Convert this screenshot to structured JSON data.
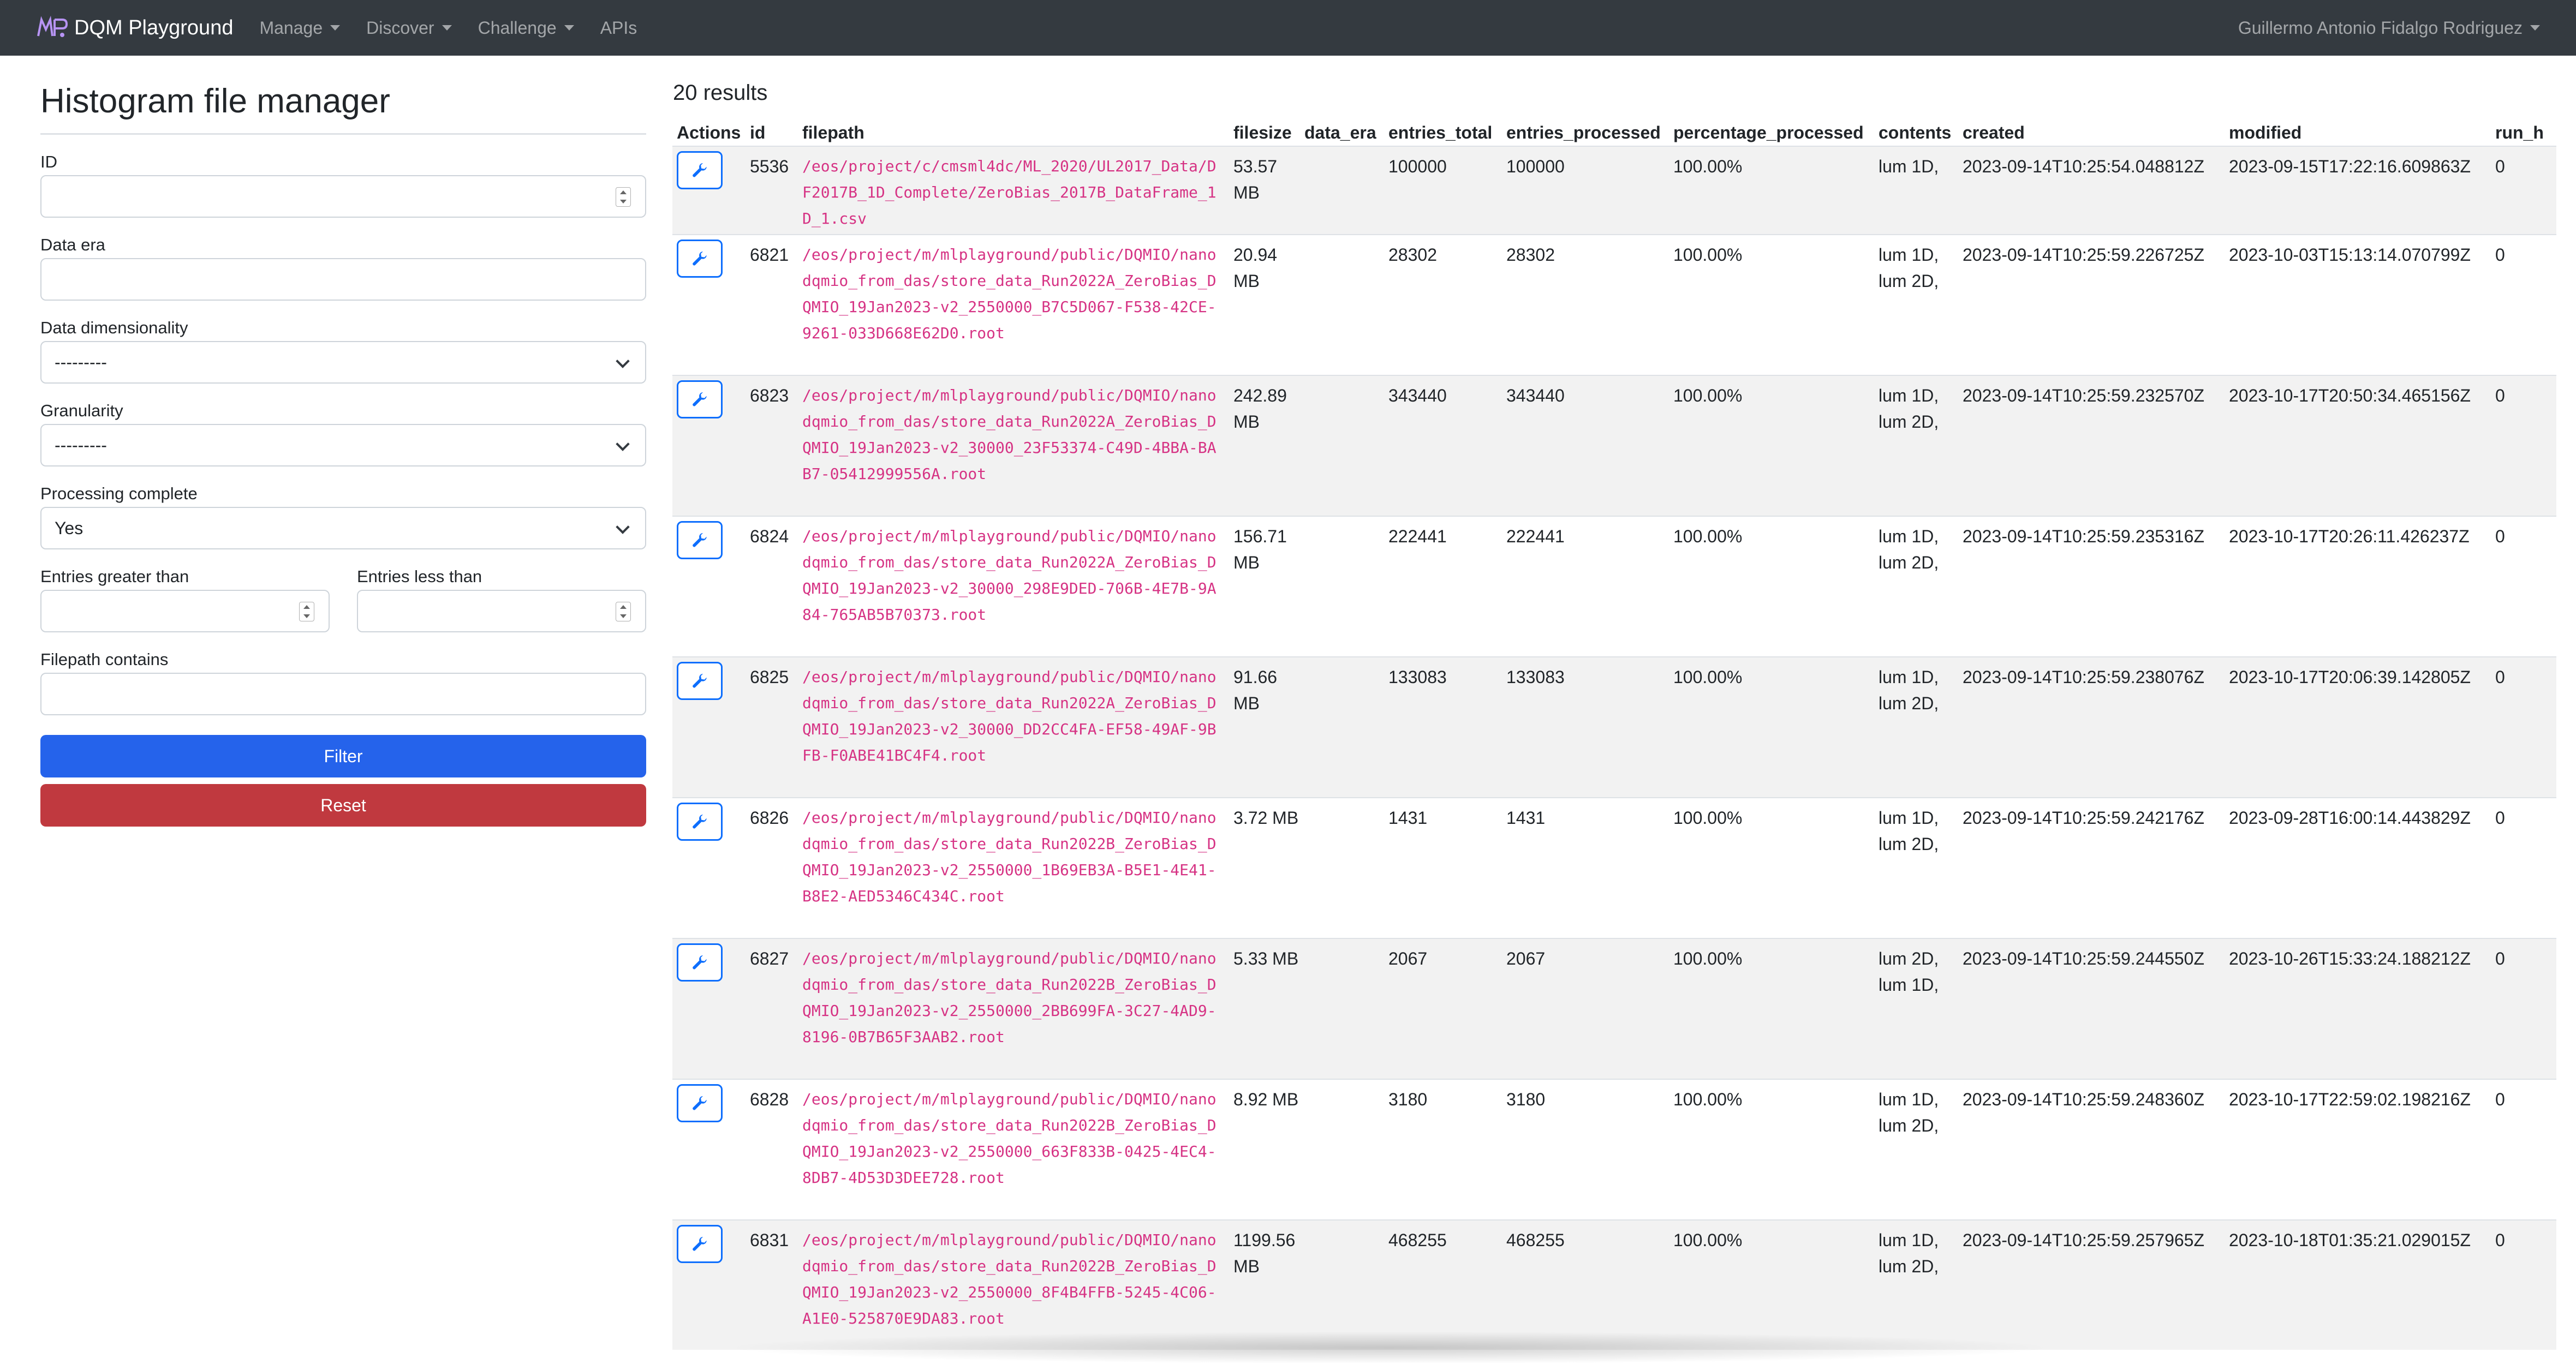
{
  "navbar": {
    "brand": "DQM Playground",
    "menu": [
      {
        "label": "Manage",
        "dropdown": true
      },
      {
        "label": "Discover",
        "dropdown": true
      },
      {
        "label": "Challenge",
        "dropdown": true
      },
      {
        "label": "APIs",
        "dropdown": false
      }
    ],
    "user": "Guillermo Antonio Fidalgo Rodriguez"
  },
  "filter_panel": {
    "title": "Histogram file manager",
    "fields": {
      "id": {
        "label": "ID",
        "value": ""
      },
      "data_era": {
        "label": "Data era",
        "value": ""
      },
      "data_dimensionality": {
        "label": "Data dimensionality",
        "value": "---------"
      },
      "granularity": {
        "label": "Granularity",
        "value": "---------"
      },
      "processing_complete": {
        "label": "Processing complete",
        "value": "Yes"
      },
      "entries_gt": {
        "label": "Entries greater than",
        "value": ""
      },
      "entries_lt": {
        "label": "Entries less than",
        "value": ""
      },
      "filepath_contains": {
        "label": "Filepath contains",
        "value": ""
      }
    },
    "filter_button": "Filter",
    "reset_button": "Reset"
  },
  "results": {
    "count_label": "20 results",
    "columns": [
      "Actions",
      "id",
      "filepath",
      "filesize",
      "data_era",
      "entries_total",
      "entries_processed",
      "percentage_processed",
      "contents",
      "created",
      "modified",
      "run_h"
    ],
    "rows": [
      {
        "id": "5536",
        "filepath": "/eos/project/c/cmsml4dc/ML_2020/UL2017_Data/DF2017B_1D_Complete/ZeroBias_2017B_DataFrame_1D_1.csv",
        "filesize": "53.57 MB",
        "data_era": "",
        "entries_total": "100000",
        "entries_processed": "100000",
        "percentage_processed": "100.00%",
        "contents": "lum 1D,",
        "created": "2023-09-14T10:25:54.048812Z",
        "modified": "2023-09-15T17:22:16.609863Z",
        "run_h": "0"
      },
      {
        "id": "6821",
        "filepath": "/eos/project/m/mlplayground/public/DQMIO/nanodqmio_from_das/store_data_Run2022A_ZeroBias_DQMIO_19Jan2023-v2_2550000_B7C5D067-F538-42CE-9261-033D668E62D0.root",
        "filesize": "20.94 MB",
        "data_era": "",
        "entries_total": "28302",
        "entries_processed": "28302",
        "percentage_processed": "100.00%",
        "contents": "lum 1D, lum 2D,",
        "created": "2023-09-14T10:25:59.226725Z",
        "modified": "2023-10-03T15:13:14.070799Z",
        "run_h": "0"
      },
      {
        "id": "6823",
        "filepath": "/eos/project/m/mlplayground/public/DQMIO/nanodqmio_from_das/store_data_Run2022A_ZeroBias_DQMIO_19Jan2023-v2_30000_23F53374-C49D-4BBA-BAB7-05412999556A.root",
        "filesize": "242.89 MB",
        "data_era": "",
        "entries_total": "343440",
        "entries_processed": "343440",
        "percentage_processed": "100.00%",
        "contents": "lum 1D, lum 2D,",
        "created": "2023-09-14T10:25:59.232570Z",
        "modified": "2023-10-17T20:50:34.465156Z",
        "run_h": "0"
      },
      {
        "id": "6824",
        "filepath": "/eos/project/m/mlplayground/public/DQMIO/nanodqmio_from_das/store_data_Run2022A_ZeroBias_DQMIO_19Jan2023-v2_30000_298E9DED-706B-4E7B-9A84-765AB5B70373.root",
        "filesize": "156.71 MB",
        "data_era": "",
        "entries_total": "222441",
        "entries_processed": "222441",
        "percentage_processed": "100.00%",
        "contents": "lum 1D, lum 2D,",
        "created": "2023-09-14T10:25:59.235316Z",
        "modified": "2023-10-17T20:26:11.426237Z",
        "run_h": "0"
      },
      {
        "id": "6825",
        "filepath": "/eos/project/m/mlplayground/public/DQMIO/nanodqmio_from_das/store_data_Run2022A_ZeroBias_DQMIO_19Jan2023-v2_30000_DD2CC4FA-EF58-49AF-9BFB-F0ABE41BC4F4.root",
        "filesize": "91.66 MB",
        "data_era": "",
        "entries_total": "133083",
        "entries_processed": "133083",
        "percentage_processed": "100.00%",
        "contents": "lum 1D, lum 2D,",
        "created": "2023-09-14T10:25:59.238076Z",
        "modified": "2023-10-17T20:06:39.142805Z",
        "run_h": "0"
      },
      {
        "id": "6826",
        "filepath": "/eos/project/m/mlplayground/public/DQMIO/nanodqmio_from_das/store_data_Run2022B_ZeroBias_DQMIO_19Jan2023-v2_2550000_1B69EB3A-B5E1-4E41-B8E2-AED5346C434C.root",
        "filesize": "3.72 MB",
        "data_era": "",
        "entries_total": "1431",
        "entries_processed": "1431",
        "percentage_processed": "100.00%",
        "contents": "lum 1D, lum 2D,",
        "created": "2023-09-14T10:25:59.242176Z",
        "modified": "2023-09-28T16:00:14.443829Z",
        "run_h": "0"
      },
      {
        "id": "6827",
        "filepath": "/eos/project/m/mlplayground/public/DQMIO/nanodqmio_from_das/store_data_Run2022B_ZeroBias_DQMIO_19Jan2023-v2_2550000_2BB699FA-3C27-4AD9-8196-0B7B65F3AAB2.root",
        "filesize": "5.33 MB",
        "data_era": "",
        "entries_total": "2067",
        "entries_processed": "2067",
        "percentage_processed": "100.00%",
        "contents": "lum 2D, lum 1D,",
        "created": "2023-09-14T10:25:59.244550Z",
        "modified": "2023-10-26T15:33:24.188212Z",
        "run_h": "0"
      },
      {
        "id": "6828",
        "filepath": "/eos/project/m/mlplayground/public/DQMIO/nanodqmio_from_das/store_data_Run2022B_ZeroBias_DQMIO_19Jan2023-v2_2550000_663F833B-0425-4EC4-8DB7-4D53D3DEE728.root",
        "filesize": "8.92 MB",
        "data_era": "",
        "entries_total": "3180",
        "entries_processed": "3180",
        "percentage_processed": "100.00%",
        "contents": "lum 1D, lum 2D,",
        "created": "2023-09-14T10:25:59.248360Z",
        "modified": "2023-10-17T22:59:02.198216Z",
        "run_h": "0"
      },
      {
        "id": "6831",
        "filepath": "/eos/project/m/mlplayground/public/DQMIO/nanodqmio_from_das/store_data_Run2022B_ZeroBias_DQMIO_19Jan2023-v2_2550000_8F4B4FFB-5245-4C06-A1E0-525870E9DA83.root",
        "filesize": "1199.56 MB",
        "data_era": "",
        "entries_total": "468255",
        "entries_processed": "468255",
        "percentage_processed": "100.00%",
        "contents": "lum 1D, lum 2D,",
        "created": "2023-09-14T10:25:59.257965Z",
        "modified": "2023-10-18T01:35:21.029015Z",
        "run_h": "0"
      }
    ]
  },
  "colors": {
    "navbar_bg": "#343a40",
    "primary": "#2563eb",
    "danger": "#c0393f",
    "filepath_text": "#d63384",
    "row_stripe": "#f2f2f2"
  },
  "icons": {
    "brand": "ml-logo-icon",
    "edit": "wrench-icon",
    "dropdown": "chevron-down-icon"
  }
}
